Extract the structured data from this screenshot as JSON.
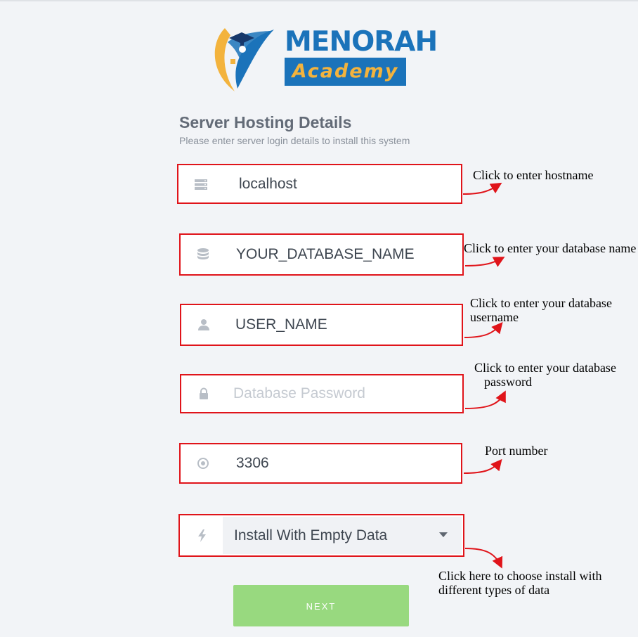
{
  "logo": {
    "line1": "MENORAH",
    "line2": "Academy",
    "colors": {
      "blue": "#1b73ba",
      "orange": "#f3b33d"
    }
  },
  "header": {
    "title": "Server Hosting Details",
    "subtitle": "Please enter server login details to install this system"
  },
  "form": {
    "hostname": {
      "value": "localhost",
      "icon": "server-icon"
    },
    "database_name": {
      "value": "YOUR_DATABASE_NAME",
      "icon": "database-icon"
    },
    "username": {
      "value": "USER_NAME",
      "icon": "user-icon"
    },
    "password": {
      "value": "",
      "placeholder": "Database Password",
      "icon": "lock-icon"
    },
    "port": {
      "value": "3306",
      "icon": "target-icon"
    },
    "install_type": {
      "selected": "Install With Empty Data",
      "icon": "bolt-icon"
    },
    "next_label": "NEXT"
  },
  "annotations": {
    "hostname": "Click to enter hostname",
    "database_name": "Click to enter your database name",
    "username_1": "Click to enter your database",
    "username_2": "username",
    "password_1": "Click to enter your database",
    "password_2": "password",
    "port": "Port number",
    "install_1": "Click here to choose install with",
    "install_2": "different types of data"
  },
  "colors": {
    "highlight_border": "#e0141a",
    "next_button": "#98d97f",
    "title_text": "#636b77"
  }
}
